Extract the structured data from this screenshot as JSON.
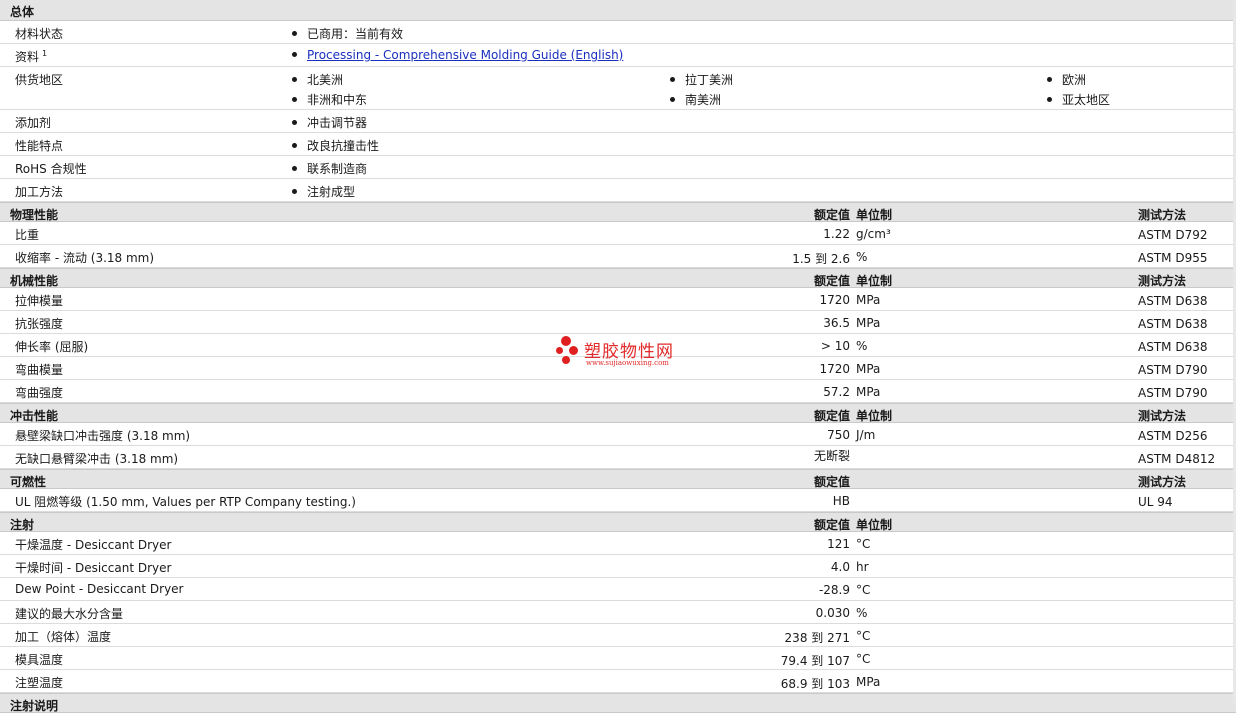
{
  "sections": {
    "general": {
      "title": "总体",
      "status_label": "材料状态",
      "status_value": "已商用：当前有效",
      "docs_label": "资料",
      "docs_sup": "1",
      "docs_link": "Processing - Comprehensive Molding Guide (English)",
      "regions_label": "供货地区",
      "regions": [
        "北美洲",
        "拉丁美洲",
        "欧洲",
        "非洲和中东",
        "南美洲",
        "亚太地区"
      ],
      "additive_label": "添加剂",
      "additive_value": "冲击调节器",
      "feature_label": "性能特点",
      "feature_value": "改良抗撞击性",
      "rohs_label": "RoHS 合规性",
      "rohs_value": "联系制造商",
      "process_label": "加工方法",
      "process_value": "注射成型"
    },
    "physical": {
      "title": "物理性能",
      "col_value": "额定值",
      "col_unit": "单位制",
      "col_method": "测试方法",
      "rows": [
        {
          "label": "比重",
          "value": "1.22",
          "unit": "g/cm³",
          "method": "ASTM D792"
        },
        {
          "label": "收缩率  - 流动  (3.18 mm)",
          "value": "1.5 到  2.6",
          "unit": "%",
          "method": "ASTM D955"
        }
      ]
    },
    "mechanical": {
      "title": "机械性能",
      "col_value": "额定值",
      "col_unit": "单位制",
      "col_method": "测试方法",
      "rows": [
        {
          "label": "拉伸模量",
          "value": "1720",
          "unit": "MPa",
          "method": "ASTM D638"
        },
        {
          "label": "抗张强度",
          "value": "36.5",
          "unit": "MPa",
          "method": "ASTM D638"
        },
        {
          "label": "伸长率  (屈服)",
          "value": "> 10",
          "unit": "%",
          "method": "ASTM D638"
        },
        {
          "label": "弯曲模量",
          "value": "1720",
          "unit": "MPa",
          "method": "ASTM D790"
        },
        {
          "label": "弯曲强度",
          "value": "57.2",
          "unit": "MPa",
          "method": "ASTM D790"
        }
      ]
    },
    "impact": {
      "title": "冲击性能",
      "col_value": "额定值",
      "col_unit": "单位制",
      "col_method": "测试方法",
      "rows": [
        {
          "label": "悬壁梁缺口冲击强度  (3.18 mm)",
          "value": "750",
          "unit": "J/m",
          "method": "ASTM D256"
        },
        {
          "label": "无缺口悬臂梁冲击  (3.18 mm)",
          "value": "无断裂",
          "unit": "",
          "method": "ASTM D4812"
        }
      ]
    },
    "flammability": {
      "title": "可燃性",
      "col_value": "额定值",
      "col_method": "测试方法",
      "rows": [
        {
          "label": "UL 阻燃等级  (1.50 mm, Values per RTP Company testing.)",
          "value": "HB",
          "unit": "",
          "method": "UL 94"
        }
      ]
    },
    "injection": {
      "title": "注射",
      "col_value": "额定值",
      "col_unit": "单位制",
      "rows": [
        {
          "label": "干燥温度  - Desiccant Dryer",
          "value": "121",
          "unit": "°C"
        },
        {
          "label": "干燥时间  - Desiccant Dryer",
          "value": "4.0",
          "unit": "hr"
        },
        {
          "label": "Dew Point - Desiccant Dryer",
          "value": "-28.9",
          "unit": "°C"
        },
        {
          "label": "建议的最大水分含量",
          "value": "0.030",
          "unit": "%"
        },
        {
          "label": "加工（熔体）温度",
          "value": "238 到  271",
          "unit": "°C"
        },
        {
          "label": "模具温度",
          "value": "79.4 到  107",
          "unit": "°C"
        },
        {
          "label": "注塑温度",
          "value": "68.9 到  103",
          "unit": "MPa"
        }
      ]
    },
    "next_title": "注射说明"
  },
  "watermark": {
    "name": "塑胶物性网",
    "url": "www.sujiaowuxing.com",
    "color": "#e02020"
  }
}
